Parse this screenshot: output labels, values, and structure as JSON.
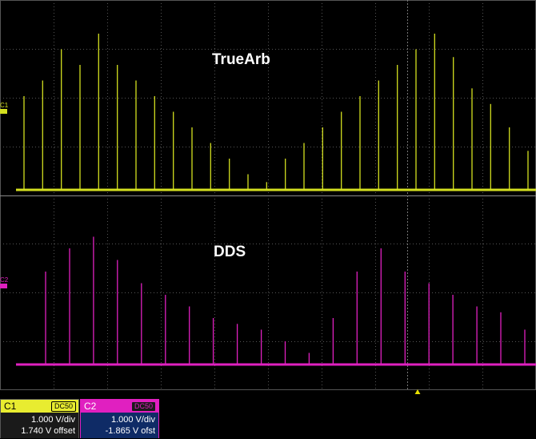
{
  "screen": {
    "trace1_label": "TrueArb",
    "trace2_label": "DDS",
    "ch1_marker": "C1",
    "ch2_marker": "C2"
  },
  "colors": {
    "ch1": "#d4e020",
    "ch2": "#e020c0",
    "grid": "#555555",
    "background": "#000000"
  },
  "traces": {
    "ch1_spike_levels": [
      0.6,
      0.7,
      0.9,
      0.8,
      1.0,
      0.8,
      0.7,
      0.6,
      0.5,
      0.4,
      0.3,
      0.2,
      0.1,
      0.05,
      0.2,
      0.3,
      0.4,
      0.5,
      0.6,
      0.7,
      0.8,
      0.9,
      1.0,
      0.85,
      0.65,
      0.55,
      0.4,
      0.25
    ],
    "ch2_spike_levels": [
      0.8,
      1.0,
      1.1,
      0.9,
      0.7,
      0.6,
      0.5,
      0.4,
      0.35,
      0.3,
      0.2,
      0.1,
      0.4,
      0.8,
      1.0,
      0.8,
      0.7,
      0.6,
      0.5,
      0.45,
      0.3
    ]
  },
  "panels": {
    "c1": {
      "name": "C1",
      "coupling": "DC50",
      "scale": "1.000 V/div",
      "offset": "1.740 V offset"
    },
    "c2": {
      "name": "C2",
      "coupling": "DC50",
      "scale": "1.000 V/div",
      "offset": "-1.865 V ofst"
    }
  }
}
